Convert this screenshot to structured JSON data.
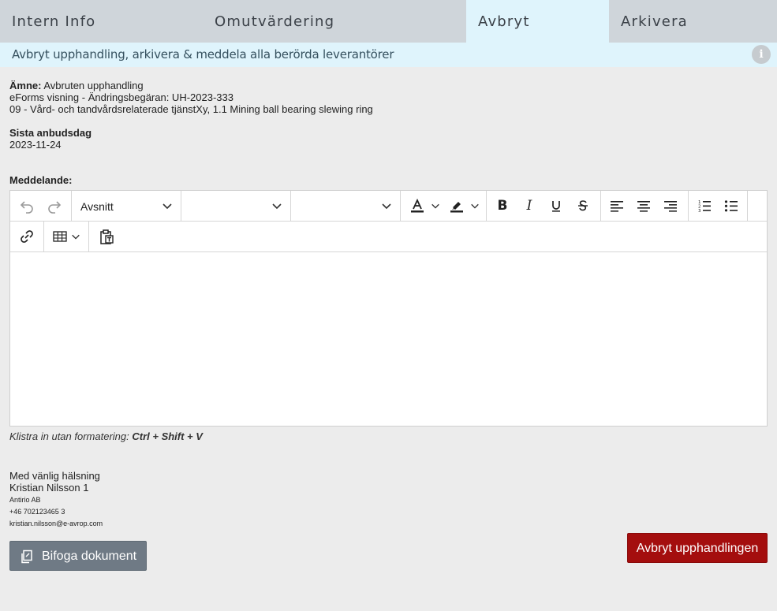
{
  "tabs": [
    {
      "label": "Intern Info"
    },
    {
      "label": "Omutvärdering"
    },
    {
      "label": "Avbryt"
    },
    {
      "label": "Arkivera"
    }
  ],
  "banner": {
    "text": "Avbryt upphandling, arkivera & meddela alla berörda leverantörer",
    "info_icon": "info-icon"
  },
  "details": {
    "subject_label": "Ämne:",
    "subject_value": "Avbruten upphandling",
    "line2": "eForms visning - Ändringsbegäran: UH-2023-333",
    "line3": "09 - Vård- och tandvårdsrelaterade tjänstXy, 1.1 Mining ball bearing slewing ring",
    "deadline_label": "Sista anbudsdag",
    "deadline_value": "2023-11-24",
    "message_label": "Meddelande:"
  },
  "editor": {
    "block_format": "Avsnitt",
    "font_family": "",
    "font_size": "",
    "body": "",
    "toolbar_icons": [
      "undo-icon",
      "redo-icon",
      "text-color-icon",
      "highlight-icon",
      "bold-icon",
      "italic-icon",
      "underline-icon",
      "strikethrough-icon",
      "align-left-icon",
      "align-center-icon",
      "align-right-icon",
      "numbered-list-icon",
      "bullet-list-icon",
      "link-icon",
      "table-icon",
      "paste-text-icon"
    ]
  },
  "hint": {
    "text": "Klistra in utan formatering: ",
    "shortcut": "Ctrl + Shift + V"
  },
  "signature": {
    "greeting": "Med vänlig hälsning",
    "name": "Kristian Nilsson 1",
    "company": "Antirio AB",
    "phone": "+46 702123465 3",
    "email": "kristian.nilsson@e-avrop.com"
  },
  "buttons": {
    "attach": "Bifoga dokument",
    "cancel": "Avbryt upphandlingen"
  },
  "colors": {
    "active_tab": "#dff4fc",
    "tab_bar": "#cfd5da",
    "cancel_button": "#a40e0e",
    "attach_button": "#6f7a85"
  }
}
